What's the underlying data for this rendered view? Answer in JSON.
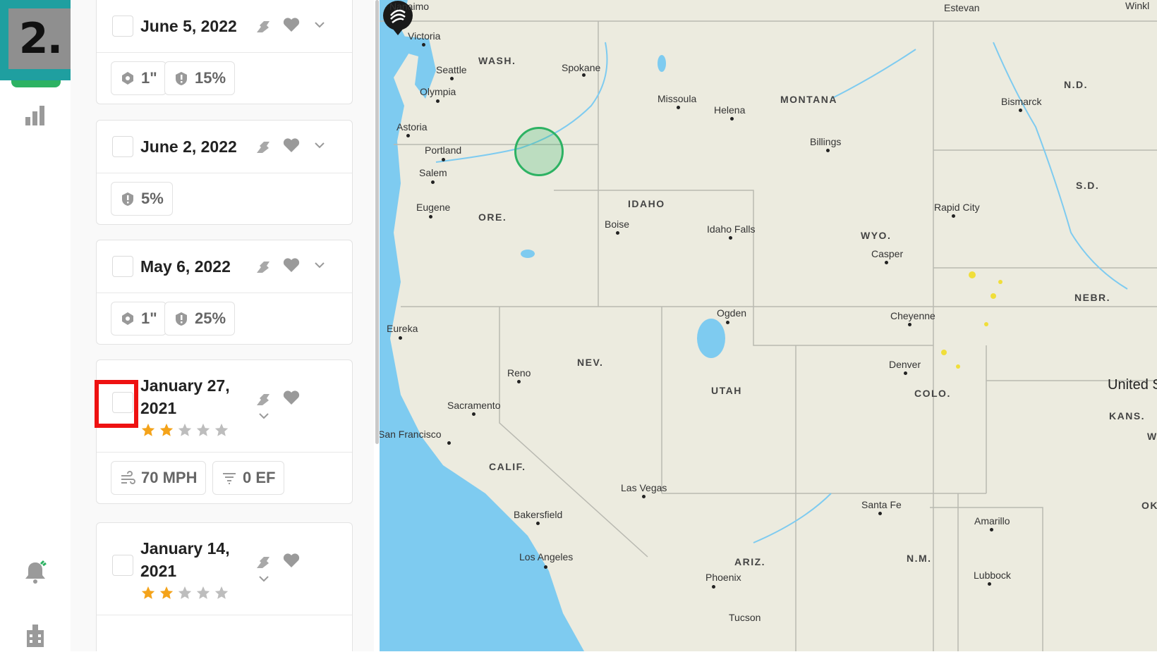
{
  "step": {
    "label": "2."
  },
  "colors": {
    "accent": "#2db263",
    "step_bg": "#1f9fa0",
    "highlight": "#ee1111",
    "star_on": "#f4a31a",
    "star_off": "#bdbdbd",
    "water": "#7ecbf0"
  },
  "rail": {
    "icons": [
      "chart-icon",
      "bell-icon",
      "building-icon"
    ]
  },
  "cards": [
    {
      "date": "June 5, 2022",
      "chips": [
        {
          "icon": "hail-size-icon",
          "text": "1\""
        },
        {
          "icon": "probability-icon",
          "text": "15%"
        }
      ]
    },
    {
      "date": "June 2, 2022",
      "chips": [
        {
          "icon": "probability-icon",
          "text": "5%"
        }
      ]
    },
    {
      "date": "May 6, 2022",
      "chips": [
        {
          "icon": "hail-size-icon",
          "text": "1\""
        },
        {
          "icon": "probability-icon",
          "text": "25%"
        }
      ]
    },
    {
      "date_line1": "January 27,",
      "date_line2": "2021",
      "rating": 2,
      "rating_max": 5,
      "chips": [
        {
          "icon": "wind-icon",
          "text": "70 MPH"
        },
        {
          "icon": "filter-icon",
          "text": "0 EF"
        }
      ]
    },
    {
      "date_line1": "January 14,",
      "date_line2": "2021",
      "rating": 2,
      "rating_max": 5
    }
  ],
  "map": {
    "cities": [
      {
        "name": "Nanaimo"
      },
      {
        "name": "Victoria"
      },
      {
        "name": "Seattle"
      },
      {
        "name": "Olympia"
      },
      {
        "name": "Spokane"
      },
      {
        "name": "Astoria"
      },
      {
        "name": "Portland"
      },
      {
        "name": "Salem"
      },
      {
        "name": "Eugene"
      },
      {
        "name": "Missoula"
      },
      {
        "name": "Helena"
      },
      {
        "name": "Billings"
      },
      {
        "name": "Boise"
      },
      {
        "name": "Idaho Falls"
      },
      {
        "name": "Casper"
      },
      {
        "name": "Eureka"
      },
      {
        "name": "Reno"
      },
      {
        "name": "Sacramento"
      },
      {
        "name": "San Francisco"
      },
      {
        "name": "Ogden"
      },
      {
        "name": "Cheyenne"
      },
      {
        "name": "Denver"
      },
      {
        "name": "Las Vegas"
      },
      {
        "name": "Bakersfield"
      },
      {
        "name": "Los Angeles"
      },
      {
        "name": "Phoenix"
      },
      {
        "name": "Santa Fe"
      },
      {
        "name": "Amarillo"
      },
      {
        "name": "Lubbock"
      },
      {
        "name": "Bismarck"
      },
      {
        "name": "Rapid City"
      },
      {
        "name": "Estevan"
      },
      {
        "name": "Winkl"
      },
      {
        "name": "Tucson"
      }
    ],
    "states": [
      "WASH.",
      "MONTANA",
      "N.D.",
      "S.D.",
      "IDAHO",
      "ORE.",
      "WYO.",
      "NEBR.",
      "NEV.",
      "UTAH",
      "COLO.",
      "KANS.",
      "CALIF.",
      "ARIZ.",
      "N.M.",
      "OK",
      "W"
    ],
    "country": "United S"
  }
}
